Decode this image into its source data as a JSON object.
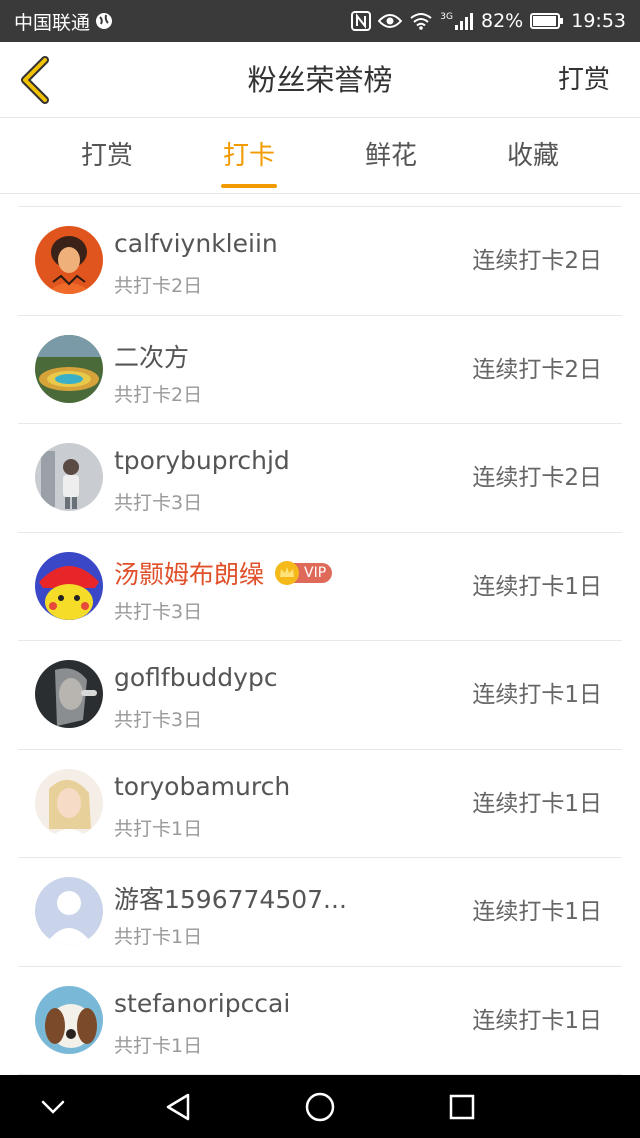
{
  "status_bar": {
    "carrier": "中国联通",
    "network": "3G",
    "battery": "82%",
    "time": "19:53"
  },
  "header": {
    "title": "粉丝荣誉榜",
    "back_icon": "chevron-left-icon",
    "right_action": "打赏"
  },
  "tabs": [
    {
      "label": "打赏",
      "active": false
    },
    {
      "label": "打卡",
      "active": true
    },
    {
      "label": "鲜花",
      "active": false
    },
    {
      "label": "收藏",
      "active": false
    }
  ],
  "accent_color": "#f29b00",
  "vip_label": "VIP",
  "rows": [
    {
      "name": "calfviynkleiin",
      "total": "共打卡2日",
      "streak": "连续打卡2日",
      "vip": false
    },
    {
      "name": "二次方",
      "total": "共打卡2日",
      "streak": "连续打卡2日",
      "vip": false
    },
    {
      "name": "tporybuprchjd",
      "total": "共打卡3日",
      "streak": "连续打卡2日",
      "vip": false
    },
    {
      "name": "汤颢姆布朗缲",
      "total": "共打卡3日",
      "streak": "连续打卡1日",
      "vip": true
    },
    {
      "name": "goflfbuddypc",
      "total": "共打卡3日",
      "streak": "连续打卡1日",
      "vip": false
    },
    {
      "name": "toryobamurch",
      "total": "共打卡1日",
      "streak": "连续打卡1日",
      "vip": false
    },
    {
      "name": "游客1596774507...",
      "total": "共打卡1日",
      "streak": "连续打卡1日",
      "vip": false
    },
    {
      "name": "stefanoripccai",
      "total": "共打卡1日",
      "streak": "连续打卡1日",
      "vip": false
    }
  ],
  "system_nav": [
    "chevron-down-icon",
    "back-triangle-icon",
    "home-circle-icon",
    "recents-square-icon"
  ]
}
